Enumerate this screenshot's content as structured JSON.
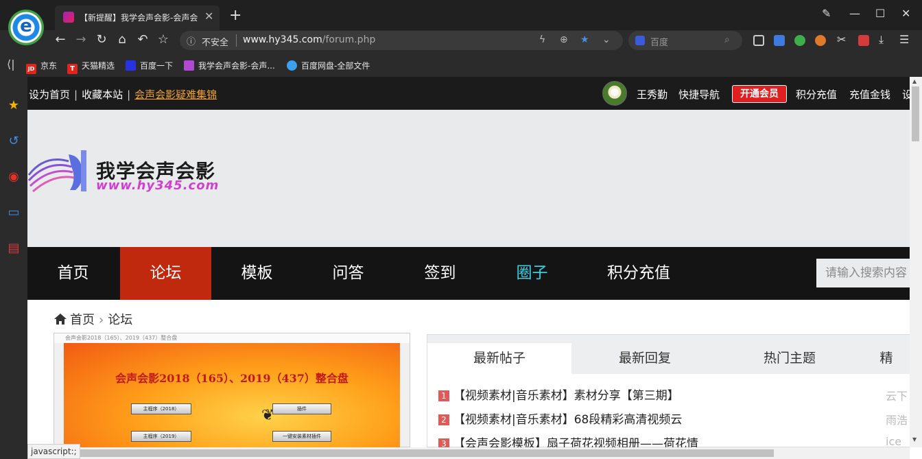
{
  "browser": {
    "tab_title": "【新提醒】我学会声会影-会声会",
    "new_tab_label": "+",
    "address": {
      "insecure_label": "不安全",
      "host": "www.hy345.com",
      "path": "/forum.php"
    },
    "search_placeholder": "百度",
    "bookmarks": [
      {
        "label": "京东",
        "icon_text": "JD",
        "color": "#e1251b"
      },
      {
        "label": "天猫精选",
        "icon_text": "T",
        "color": "#e1251b"
      },
      {
        "label": "百度一下",
        "icon_text": "",
        "color": "#2932e1"
      },
      {
        "label": "我学会声会影-会声...",
        "icon_text": "",
        "color": "#b04ad0"
      },
      {
        "label": "百度网盘-全部文件",
        "icon_text": "",
        "color": "#3aa0f0"
      }
    ],
    "status_tip": "javascript:;"
  },
  "site": {
    "topbar": {
      "set_home": "设为首页",
      "bookmark_site": "收藏本站",
      "faq": "会声会影疑难集锦",
      "username": "王秀勤",
      "quick_nav": "快捷导航",
      "vip": "开通会员",
      "points_recharge": "积分充值",
      "money_recharge": "充值金钱",
      "more": "设"
    },
    "logo": {
      "title": "我学会声会影",
      "url": "www.hy345.com"
    },
    "nav": {
      "items": [
        "首页",
        "论坛",
        "模板",
        "问答",
        "签到",
        "圈子",
        "积分充值"
      ],
      "search_placeholder": "请输入搜索内容"
    },
    "breadcrumb": {
      "home": "首页",
      "current": "论坛"
    },
    "slide": {
      "window_title": "会声会影2018（165）、2019（437）整合盘",
      "title": "会声会影2018（165）、2019（437）整合盘",
      "buttons": [
        "主程序（2018）",
        "插件",
        "主程序（2019）",
        "一键安装素材插件"
      ]
    },
    "panel": {
      "tabs": [
        "最新帖子",
        "最新回复",
        "热门主题",
        "精"
      ],
      "posts": [
        {
          "num": "1",
          "title": "【视频素材|音乐素材】素材分享【第三期】",
          "author": "云下"
        },
        {
          "num": "2",
          "title": "【视频素材|音乐素材】68段精彩高清视频云",
          "author": "雨浩"
        },
        {
          "num": "3",
          "title": "【会声会影模板】扇子荷花视频相册——荷花情",
          "author": "ice"
        }
      ]
    }
  }
}
